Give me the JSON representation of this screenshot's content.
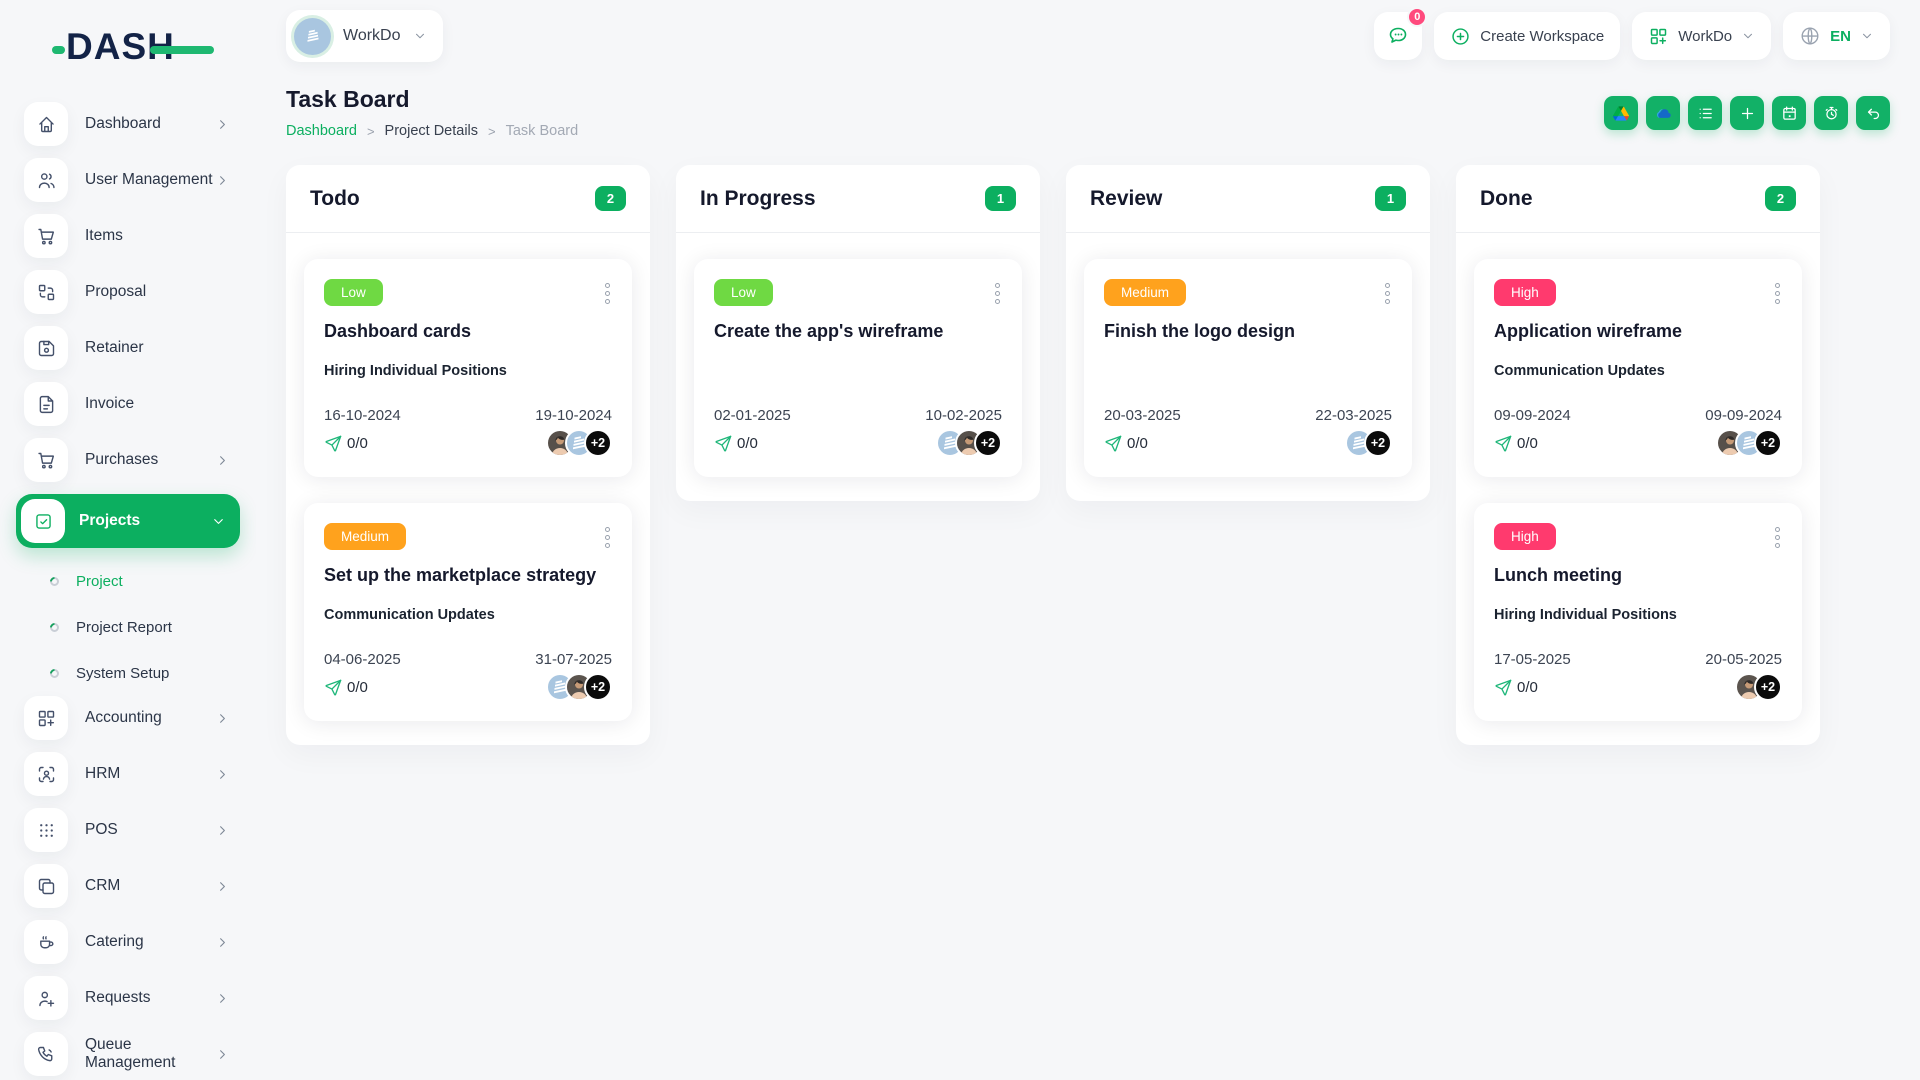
{
  "theme": {
    "primary_green": "#0CAF60",
    "low_green": "#6FD943",
    "medium_orange": "#FFA21D",
    "high_pink": "#FF3A6E",
    "notification_pink": "#FF4A7D"
  },
  "brand": {
    "logo_text": "DASH"
  },
  "topbar": {
    "workspace": {
      "label": "WorkDo",
      "avatar_icon": "building-icon"
    },
    "messages": {
      "icon": "chat-bubble-icon",
      "badge": "0"
    },
    "create_workspace": {
      "icon": "circle-plus-icon",
      "label": "Create Workspace"
    },
    "apps": {
      "icon": "grid-plus-icon",
      "label": "WorkDo"
    },
    "language": {
      "icon": "globe-icon",
      "label": "EN"
    }
  },
  "sidebar": {
    "items": [
      {
        "label": "Dashboard",
        "icon": "home-icon"
      },
      {
        "label": "User Management",
        "icon": "users-icon"
      },
      {
        "label": "Items",
        "icon": "cart-icon"
      },
      {
        "label": "Proposal",
        "icon": "transform-icon"
      },
      {
        "label": "Retainer",
        "icon": "floppy-icon"
      },
      {
        "label": "Invoice",
        "icon": "file-invoice-icon"
      },
      {
        "label": "Purchases",
        "icon": "cart-icon"
      },
      {
        "label": "Projects",
        "icon": "checkbox-icon"
      },
      {
        "label": "Accounting",
        "icon": "grid-plus-icon"
      },
      {
        "label": "HRM",
        "icon": "user-scan-icon"
      },
      {
        "label": "POS",
        "icon": "grid-dots-icon"
      },
      {
        "label": "CRM",
        "icon": "copy-icon"
      },
      {
        "label": "Catering",
        "icon": "coffee-icon"
      },
      {
        "label": "Requests",
        "icon": "user-plus-icon"
      },
      {
        "label": "Queue Management",
        "icon": "phone-call-icon"
      }
    ],
    "projects_submenu": [
      {
        "label": "Project"
      },
      {
        "label": "Project Report"
      },
      {
        "label": "System Setup"
      }
    ]
  },
  "page": {
    "title": "Task Board",
    "breadcrumb": {
      "items": [
        "Dashboard",
        "Project Details",
        "Task Board"
      ],
      "separator": ">"
    },
    "action_icons": [
      "google-drive",
      "one-drive",
      "list",
      "plus",
      "calendar",
      "timer",
      "undo"
    ]
  },
  "board": {
    "columns": [
      {
        "title": "Todo",
        "count": "2",
        "cards": [
          {
            "priority": "Low",
            "title": "Dashboard cards",
            "project": "Hiring Individual Positions",
            "start_date": "16-10-2024",
            "end_date": "19-10-2024",
            "message_count": "0/0",
            "more_members": "+2"
          },
          {
            "priority": "Medium",
            "title": "Set up the marketplace strategy",
            "project": "Communication Updates",
            "start_date": "04-06-2025",
            "end_date": "31-07-2025",
            "message_count": "0/0",
            "more_members": "+2"
          }
        ]
      },
      {
        "title": "In Progress",
        "count": "1",
        "cards": [
          {
            "priority": "Low",
            "title": "Create the app's wireframe",
            "project": "",
            "start_date": "02-01-2025",
            "end_date": "10-02-2025",
            "message_count": "0/0",
            "more_members": "+2"
          }
        ]
      },
      {
        "title": "Review",
        "count": "1",
        "cards": [
          {
            "priority": "Medium",
            "title": "Finish the logo design",
            "project": "",
            "start_date": "20-03-2025",
            "end_date": "22-03-2025",
            "message_count": "0/0",
            "more_members": "+2"
          }
        ]
      },
      {
        "title": "Done",
        "count": "2",
        "cards": [
          {
            "priority": "High",
            "title": "Application wireframe",
            "project": "Communication Updates",
            "start_date": "09-09-2024",
            "end_date": "09-09-2024",
            "message_count": "0/0",
            "more_members": "+2"
          },
          {
            "priority": "High",
            "title": "Lunch meeting",
            "project": "Hiring Individual Positions",
            "start_date": "17-05-2025",
            "end_date": "20-05-2025",
            "message_count": "0/0",
            "more_members": "+2"
          }
        ]
      }
    ]
  }
}
